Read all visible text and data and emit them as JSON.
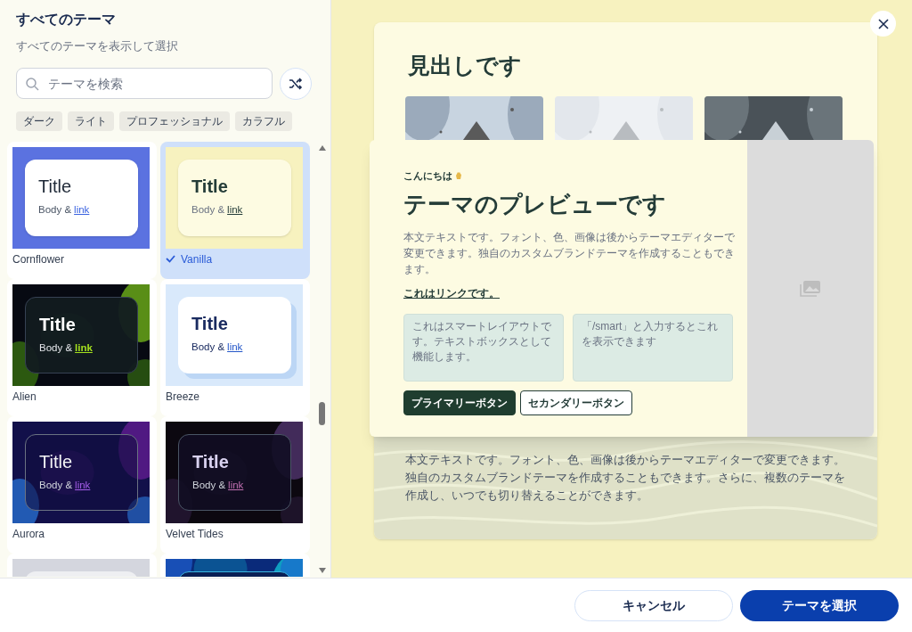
{
  "sidebar": {
    "title": "すべてのテーマ",
    "subtitle": "すべてのテーマを表示して選択",
    "search": {
      "placeholder": "テーマを検索"
    },
    "filters": [
      "ダーク",
      "ライト",
      "プロフェッショナル",
      "カラフル"
    ],
    "themes": [
      {
        "kind": "cornflower",
        "name": "Cornflower",
        "title": "Title",
        "body": "Body &",
        "link": "link",
        "selected": false
      },
      {
        "kind": "vanilla",
        "name": "Vanilla",
        "title": "Title",
        "body": "Body &",
        "link": "link",
        "selected": true
      },
      {
        "kind": "alien",
        "name": "Alien",
        "title": "Title",
        "body": "Body &",
        "link": "link",
        "selected": false
      },
      {
        "kind": "breeze",
        "name": "Breeze",
        "title": "Title",
        "body": "Body &",
        "link": "link",
        "selected": false
      },
      {
        "kind": "aurora",
        "name": "Aurora",
        "title": "Title",
        "body": "Body &",
        "link": "link",
        "selected": false
      },
      {
        "kind": "velvet",
        "name": "Velvet Tides",
        "title": "Title",
        "body": "Body &",
        "link": "link",
        "selected": false
      },
      {
        "kind": "silver",
        "selected": false
      },
      {
        "kind": "ocean",
        "selected": false
      }
    ]
  },
  "preview": {
    "back_card": {
      "heading": "見出しです",
      "body": "本文テキストです。フォント、色、画像は後からテーマエディターで変更できます。独自のカスタムブランドテーマを作成することもできます。さらに、複数のテーマを作成し、いつでも切り替えることができます。"
    },
    "front_card": {
      "greeting": "こんにちは",
      "title": "テーマのプレビューです",
      "body": "本文テキストです。フォント、色、画像は後からテーマエディターで変更できます。独自のカスタムブランドテーマを作成することもできます。",
      "link": "これはリンクです。",
      "boxes": [
        "これはスマートレイアウトです。テキストボックスとして機能します。",
        "「/smart」と入力するとこれを表示できます"
      ],
      "buttons": [
        {
          "kind": "primary",
          "label": "プライマリーボタン"
        },
        {
          "kind": "secondary",
          "label": "セカンダリーボタン"
        }
      ]
    }
  },
  "footer": {
    "buttons": [
      {
        "kind": "secondary",
        "label": "キャンセル"
      },
      {
        "kind": "primary",
        "label": "テーマを選択"
      }
    ]
  }
}
